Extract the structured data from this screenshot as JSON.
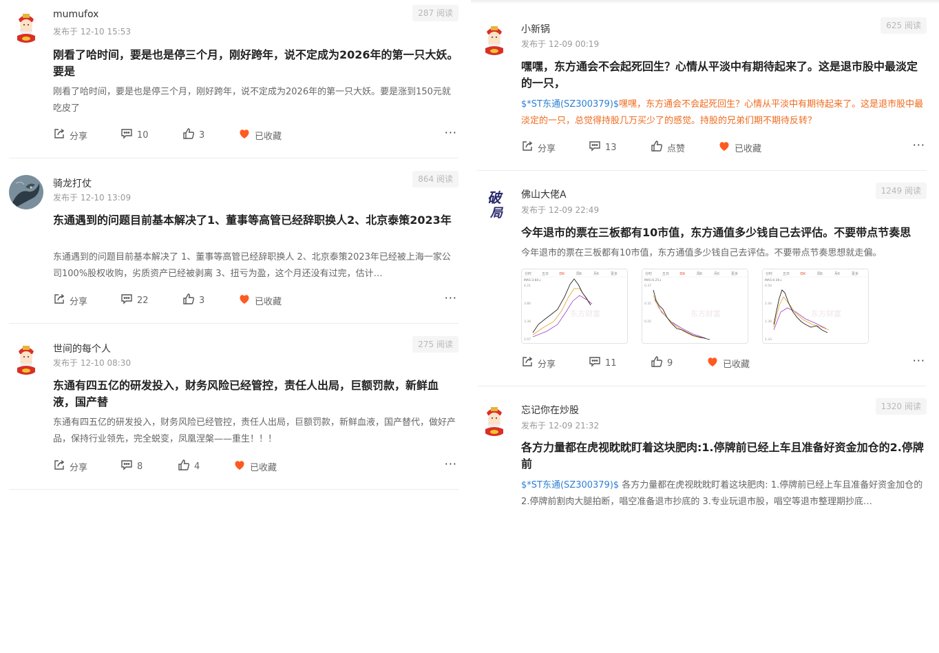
{
  "ui": {
    "share": "分享",
    "collected": "已收藏",
    "like": "点赞",
    "more": "···",
    "read_suffix": "阅读"
  },
  "colors": {
    "heart": "#ff5a1f",
    "stock_link": "#2d7fd3",
    "orange_text": "#ef6b1e"
  },
  "left_posts": [
    {
      "user": "mumufox",
      "time": "发布于 12-10 15:53",
      "reads": "287 阅读",
      "title": "刚看了哈时间，要是也是停三个月，刚好跨年，说不定成为2026年的第一只大妖。要是",
      "excerpt": "刚看了哈时间，要是也是停三个月，刚好跨年，说不定成为2026年的第一只大妖。要是涨到150元就吃皮了",
      "comments": "10",
      "likes": "3",
      "avatar": "caishen-avatar"
    },
    {
      "user": "骑龙打仗",
      "time": "发布于 12-10 13:09",
      "reads": "864 阅读",
      "title": "东通遇到的问题目前基本解决了1、董事等高管已经辞职换人2、北京泰策2023年",
      "excerpt": "东通遇到的问题目前基本解决了 1、董事等高管已经辞职换人 2、北京泰策2023年已经被上海一家公司100%股权收购，劣质资产已经被剥离 3、扭亏为盈，这个月还没有过完，估计…",
      "comments": "22",
      "likes": "3",
      "avatar": "dragon-avatar"
    },
    {
      "user": "世间的每个人",
      "time": "发布于 12-10 08:30",
      "reads": "275 阅读",
      "title": "东通有四五亿的研发投入，财务风险已经管控，责任人出局，巨额罚款，新鲜血液，国产替",
      "excerpt": "东通有四五亿的研发投入，财务风险已经管控，责任人出局，巨额罚款，新鲜血液，国产替代，做好产品，保持行业领先，完全蜕变，凤凰涅槃——重生！！！",
      "comments": "8",
      "likes": "4",
      "avatar": "caishen-avatar"
    }
  ],
  "right_posts": [
    {
      "user": "小新锅",
      "time": "发布于 12-09 00:19",
      "reads": "625 阅读",
      "title": "嘿嘿，东方通会不会起死回生？心情从平淡中有期待起来了。这是退市股中最淡定的一只，",
      "stock": "$*ST东通(SZ300379)$",
      "excerpt": "嘿嘿，东方通会不会起死回生？心情从平淡中有期待起来了。这是退市股中最淡定的一只，总觉得持股几万买少了的感觉。持股的兄弟们期不期待反转？",
      "comments": "13",
      "likes": "点赞",
      "avatar": "caishen-avatar"
    },
    {
      "user": "佛山大佬A",
      "time": "发布于 12-09 22:49",
      "reads": "1249 阅读",
      "title": "今年退市的票在三板都有10市值，东方通值多少钱自己去评估。不要带点节奏思",
      "excerpt": "今年退市的票在三板都有10市值，东方通值多少钱自己去评估。不要带点节奏思想就走偏。",
      "comments": "11",
      "likes": "9",
      "avatar": "poju-calligraphy-avatar",
      "avatar_text": "破局",
      "thumbs": [
        {
          "tabs": [
            "分时",
            "五日",
            "日K",
            "周K",
            "月K",
            "更多"
          ],
          "ma": "MA5:3.60↓",
          "watermark": "东方财富",
          "y": [
            "4.21",
            "3.80",
            "3.38",
            "2.97"
          ]
        },
        {
          "tabs": [
            "分时",
            "五日",
            "日K",
            "周K",
            "月K",
            "更多"
          ],
          "ma": "MA5:0.25↓",
          "watermark": "东方财富",
          "y": [
            "0.37",
            "0.31",
            "0.25"
          ]
        },
        {
          "tabs": [
            "分时",
            "五日",
            "日K",
            "周K",
            "月K",
            "更多"
          ],
          "ma": "MA5:0.39↓",
          "watermark": "东方财富",
          "y": [
            "0.50",
            "1.44",
            "1.38",
            "1.33"
          ]
        }
      ]
    },
    {
      "user": "忘记你在炒股",
      "time": "发布于 12-09 21:32",
      "reads": "1320 阅读",
      "title": "各方力量都在虎视眈眈盯着这块肥肉:1.停牌前已经上车且准备好资金加仓的2.停牌前",
      "stock": "$*ST东通(SZ300379)$",
      "excerpt": " 各方力量都在虎视眈眈盯着这块肥肉: 1.停牌前已经上车且准备好资金加仓的 2.停牌前割肉大腿拍断，唱空准备退市抄底的 3.专业玩退市股，唱空等退市整理期抄底…",
      "avatar": "caishen-avatar"
    }
  ]
}
